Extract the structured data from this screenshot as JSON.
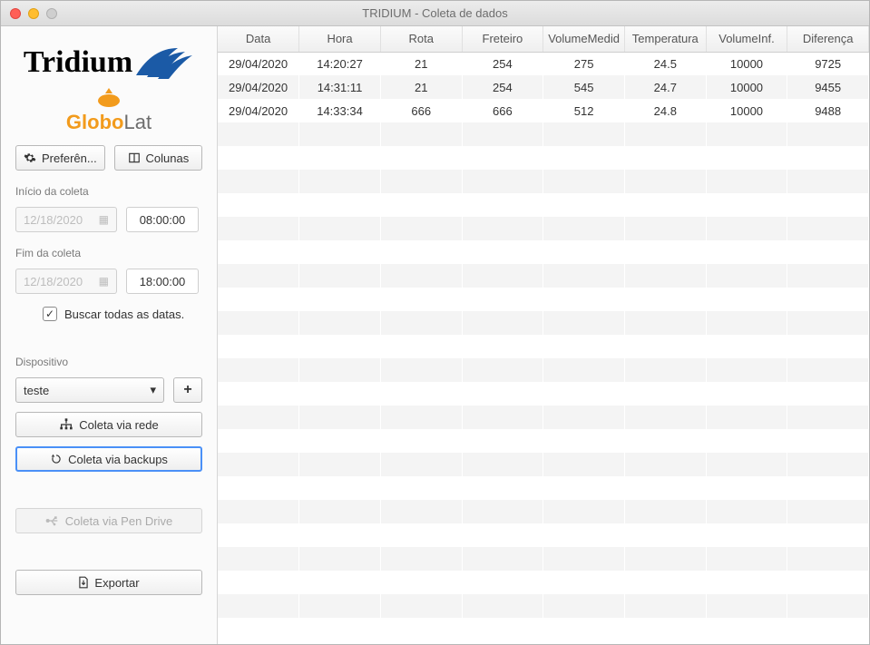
{
  "window": {
    "title": "TRIDIUM - Coleta de dados"
  },
  "sidebar": {
    "logo_tridium": "Tridium",
    "logo_globo_g": "Globo",
    "logo_globo_rest": "Lat",
    "preferences_label": "Preferên...",
    "columns_label": "Colunas",
    "start_section": "Início da coleta",
    "end_section": "Fim da coleta",
    "start_date": "12/18/2020",
    "start_time": "08:00:00",
    "end_date": "12/18/2020",
    "end_time": "18:00:00",
    "search_all_label": "Buscar todas as datas.",
    "search_all_checked": true,
    "device_section": "Dispositivo",
    "device_value": "teste",
    "btn_network": "Coleta via rede",
    "btn_backups": "Coleta via backups",
    "btn_pendrive": "Coleta via Pen Drive",
    "btn_export": "Exportar"
  },
  "table": {
    "columns": [
      "Data",
      "Hora",
      "Rota",
      "Freteiro",
      "VolumeMedid",
      "Temperatura",
      "VolumeInf.",
      "Diferença"
    ],
    "rows": [
      [
        "29/04/2020",
        "14:20:27",
        "21",
        "254",
        "275",
        "24.5",
        "10000",
        "9725"
      ],
      [
        "29/04/2020",
        "14:31:11",
        "21",
        "254",
        "545",
        "24.7",
        "10000",
        "9455"
      ],
      [
        "29/04/2020",
        "14:33:34",
        "666",
        "666",
        "512",
        "24.8",
        "10000",
        "9488"
      ]
    ],
    "blank_rows": 21
  }
}
